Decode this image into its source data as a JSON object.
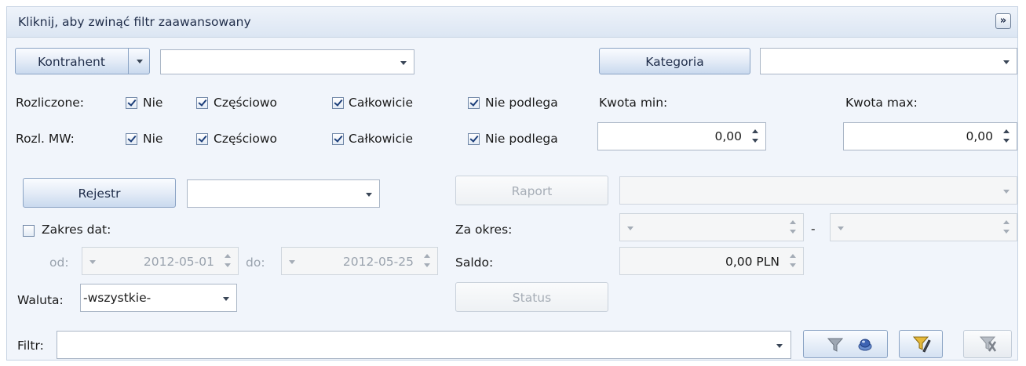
{
  "header": {
    "title": "Kliknij, aby zwinąć filtr zaawansowany",
    "collapse_icon": "double-chevron-down-icon"
  },
  "kontrahent": {
    "button_label": "Kontrahent",
    "value": ""
  },
  "kategoria": {
    "button_label": "Kategoria",
    "value": ""
  },
  "rozliczone": {
    "label": "Rozliczone:",
    "options": [
      {
        "label": "Nie",
        "checked": true
      },
      {
        "label": "Częściowo",
        "checked": true
      },
      {
        "label": "Całkowicie",
        "checked": true
      },
      {
        "label": "Nie podlega",
        "checked": true
      }
    ]
  },
  "rozl_mw": {
    "label": "Rozl. MW:",
    "options": [
      {
        "label": "Nie",
        "checked": true
      },
      {
        "label": "Częściowo",
        "checked": true
      },
      {
        "label": "Całkowicie",
        "checked": true
      },
      {
        "label": "Nie podlega",
        "checked": true
      }
    ]
  },
  "kwota_min": {
    "label": "Kwota min:",
    "value": "0,00"
  },
  "kwota_max": {
    "label": "Kwota max:",
    "value": "0,00"
  },
  "rejestr": {
    "button_label": "Rejestr",
    "value": ""
  },
  "zakres_dat": {
    "label": "Zakres dat:",
    "checked": false,
    "od_label": "od:",
    "od_value": "2012-05-01",
    "do_label": "do:",
    "do_value": "2012-05-25"
  },
  "waluta": {
    "label": "Waluta:",
    "value": "-wszystkie-"
  },
  "raport": {
    "button_label": "Raport",
    "value": ""
  },
  "za_okres": {
    "label": "Za okres:",
    "separator": "-",
    "from": "",
    "to": ""
  },
  "saldo": {
    "label": "Saldo:",
    "value": "0,00 PLN"
  },
  "status": {
    "button_label": "Status"
  },
  "filtr": {
    "label": "Filtr:",
    "value": ""
  },
  "toolbar": {
    "icons": [
      "funnel-icon",
      "clear-icon",
      "funnel-edit-icon",
      "funnel-remove-icon"
    ]
  },
  "colors": {
    "accent": "#c9d9ee",
    "panel": "#f1f5fb",
    "border": "#8aa3c4"
  }
}
